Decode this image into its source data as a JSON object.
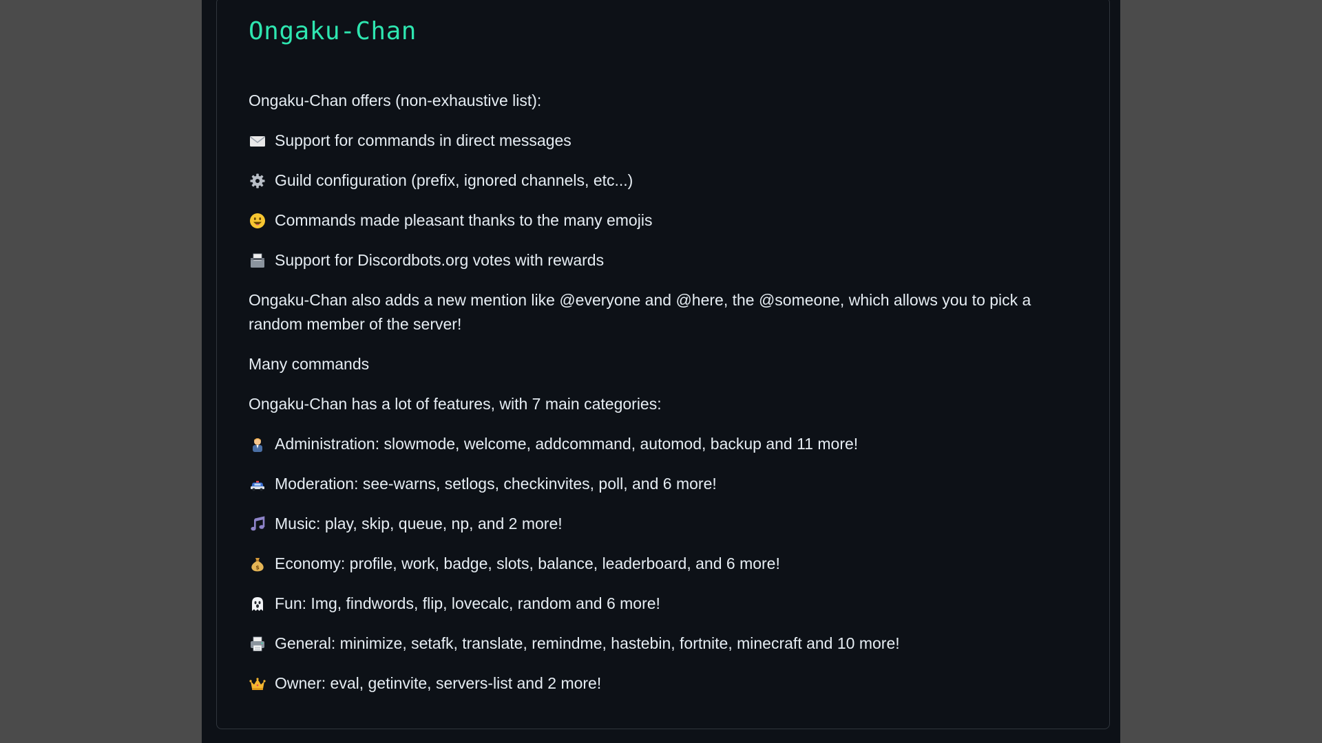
{
  "page": {
    "title": "Ongaku-Chan",
    "intro": "Ongaku-Chan offers (non-exhaustive list):",
    "offers": [
      {
        "icon": "envelope-icon",
        "text": "Support for commands in direct messages"
      },
      {
        "icon": "gear-icon",
        "text": "Guild configuration (prefix, ignored channels, etc...)"
      },
      {
        "icon": "smiley-face-icon",
        "text": "Commands made pleasant thanks to the many emojis"
      },
      {
        "icon": "ballot-box-icon",
        "text": "Support for Discordbots.org votes with rewards"
      }
    ],
    "mention_text": "Ongaku-Chan also adds a new mention like @everyone and @here, the @someone, which allows you to pick a random member of the server!",
    "many_commands": "Many commands",
    "features_intro": "Ongaku-Chan has a lot of features, with 7 main categories:",
    "categories": [
      {
        "icon": "person-icon",
        "text": "Administration: slowmode, welcome, addcommand, automod, backup and 11 more!"
      },
      {
        "icon": "police-car-icon",
        "text": "Moderation: see-warns, setlogs, checkinvites, poll, and 6 more!"
      },
      {
        "icon": "music-note-icon",
        "text": "Music: play, skip, queue, np, and 2 more!"
      },
      {
        "icon": "money-bag-icon",
        "text": "Economy: profile, work, badge, slots, balance, leaderboard, and 6 more!"
      },
      {
        "icon": "ghost-icon",
        "text": "Fun: Img, findwords, flip, lovecalc, random and 6 more!"
      },
      {
        "icon": "printer-icon",
        "text": "General: minimize, setafk, translate, remindme, hastebin, fortnite, minecraft and 10 more!"
      },
      {
        "icon": "crown-icon",
        "text": "Owner: eval, getinvite, servers-list and 2 more!"
      }
    ]
  }
}
